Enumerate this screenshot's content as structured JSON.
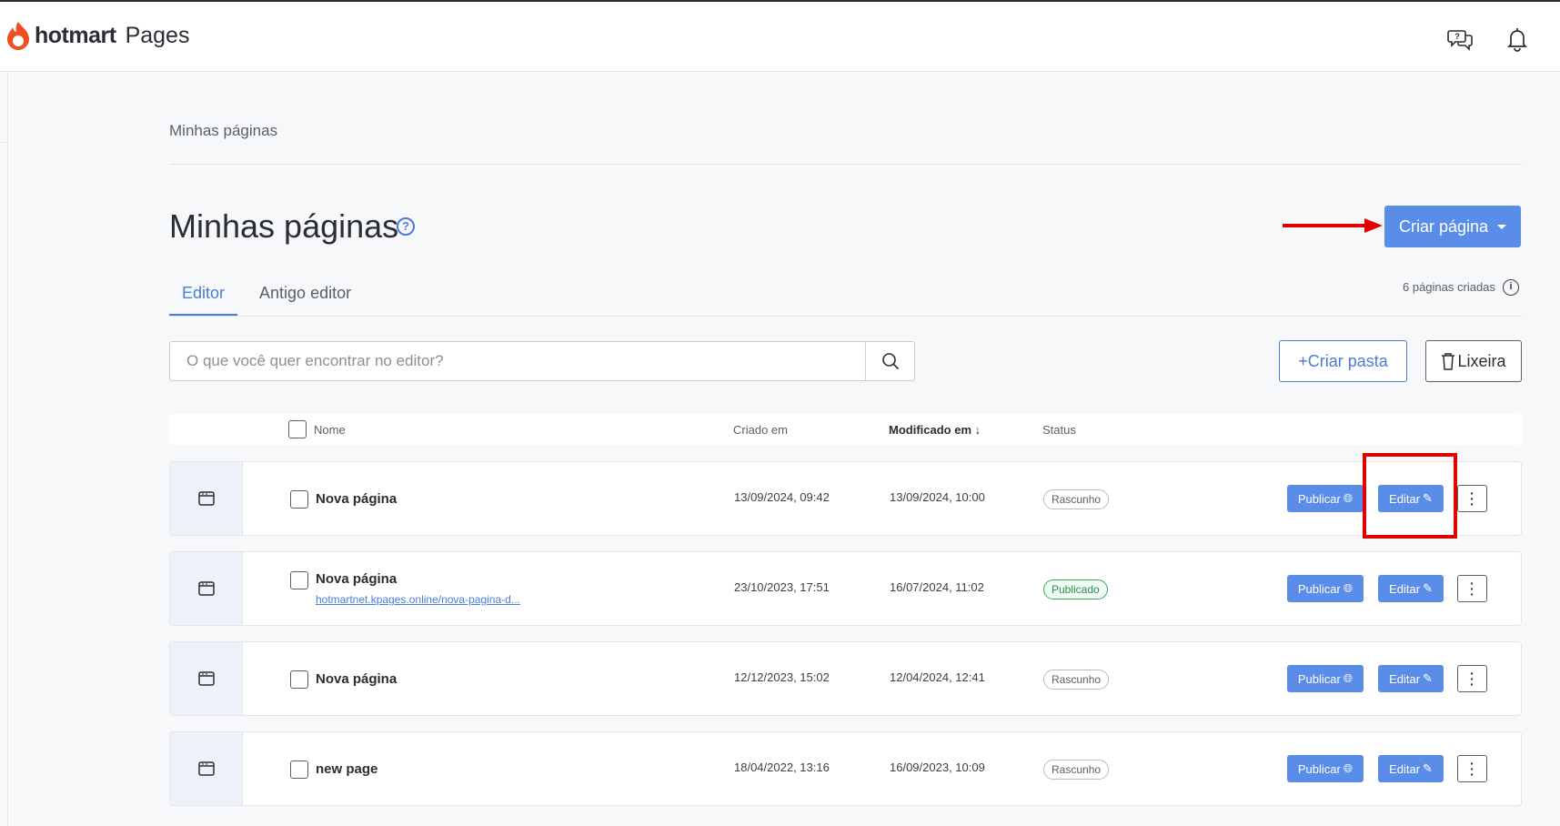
{
  "header": {
    "brand": "hotmart",
    "product": "Pages",
    "icons": [
      "help-chat-icon",
      "bell-icon"
    ]
  },
  "breadcrumb": "Minhas páginas",
  "page_title": "Minhas páginas",
  "create_button": "Criar página",
  "tabs": [
    {
      "label": "Editor",
      "active": true
    },
    {
      "label": "Antigo editor",
      "active": false
    }
  ],
  "pages_count": "6 páginas criadas",
  "search": {
    "placeholder": "O que você quer encontrar no editor?",
    "value": ""
  },
  "create_folder_button": "+Criar pasta",
  "trash_button": "Lixeira",
  "table": {
    "headers": {
      "name": "Nome",
      "created": "Criado em",
      "modified": "Modificado em",
      "status": "Status"
    },
    "rows": [
      {
        "name": "Nova página",
        "url": "",
        "created": "13/09/2024, 09:42",
        "modified": "13/09/2024, 10:00",
        "status": "Rascunho",
        "publish": "Publicar",
        "edit": "Editar"
      },
      {
        "name": "Nova página",
        "url": "hotmartnet.kpages.online/nova-pagina-d...",
        "created": "23/10/2023, 17:51",
        "modified": "16/07/2024, 11:02",
        "status": "Publicado",
        "publish": "Publicar",
        "edit": "Editar"
      },
      {
        "name": "Nova página",
        "url": "",
        "created": "12/12/2023, 15:02",
        "modified": "12/04/2024, 12:41",
        "status": "Rascunho",
        "publish": "Publicar",
        "edit": "Editar"
      },
      {
        "name": "new page",
        "url": "",
        "created": "18/04/2022, 13:16",
        "modified": "16/09/2023, 10:09",
        "status": "Rascunho",
        "publish": "Publicar",
        "edit": "Editar"
      }
    ]
  },
  "colors": {
    "accent": "#5a8de8",
    "annotation": "#e10000",
    "published": "#3ea865",
    "brand_flame": "#f04e23"
  }
}
